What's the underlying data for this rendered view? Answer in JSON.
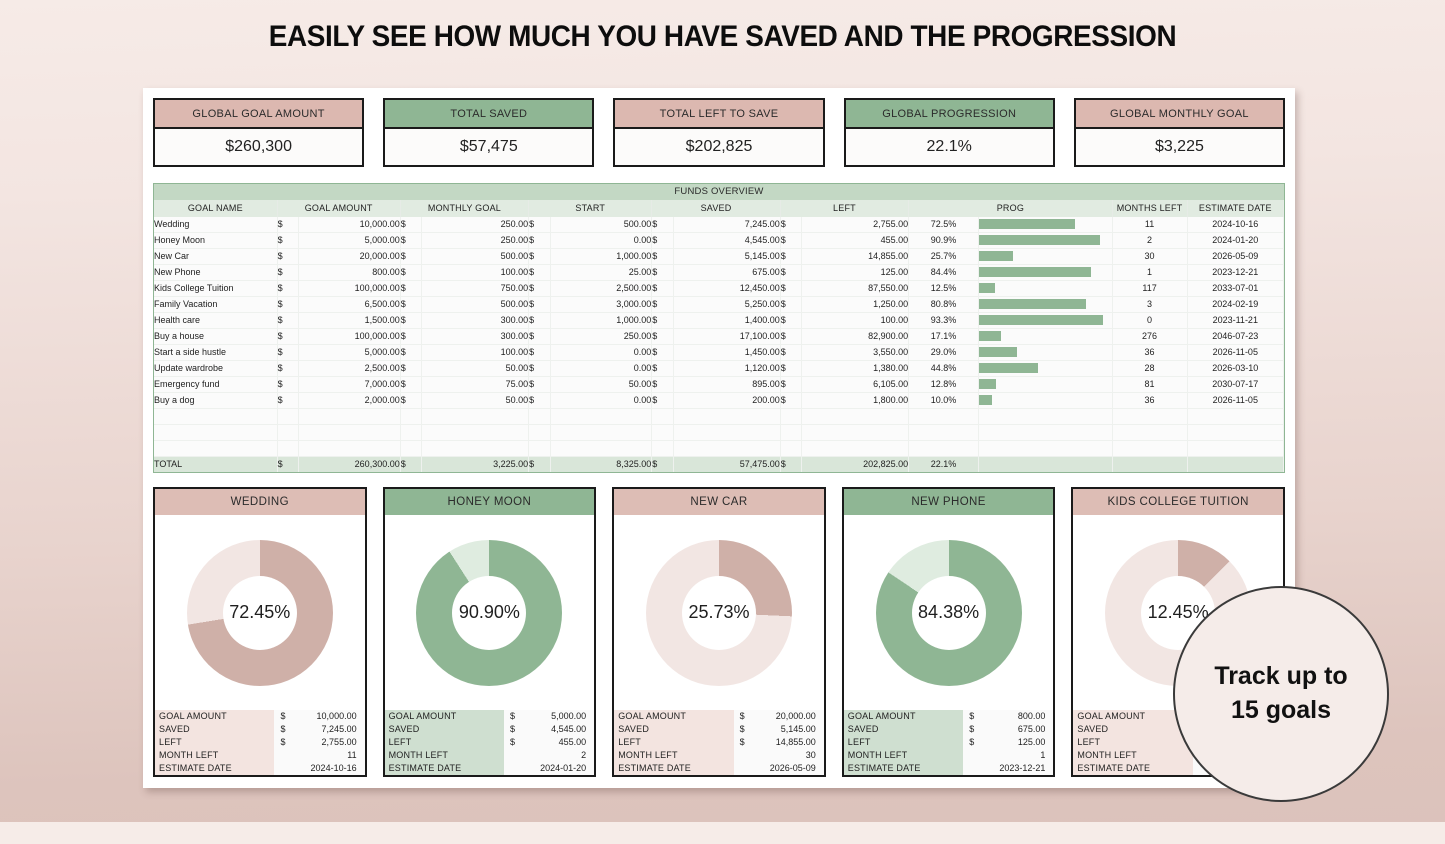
{
  "page": {
    "title": "EASILY SEE HOW MUCH YOU HAVE SAVED AND THE PROGRESSION",
    "badge_line1": "Track up to",
    "badge_line2": "15 goals"
  },
  "colors": {
    "pink_header": "#dcb8b0",
    "green_header": "#8fb694",
    "pink_fill": "#cfb0a8",
    "pink_track": "#f2e6e3",
    "green_fill": "#8fb694",
    "green_track": "#dfece0",
    "table_header": "#e1ebe1",
    "total_row": "#d9e6d9"
  },
  "kpis": [
    {
      "label": "GLOBAL GOAL AMOUNT",
      "value": "$260,300",
      "tone": "pink"
    },
    {
      "label": "TOTAL SAVED",
      "value": "$57,475",
      "tone": "green"
    },
    {
      "label": "TOTAL LEFT TO SAVE",
      "value": "$202,825",
      "tone": "pink"
    },
    {
      "label": "GLOBAL PROGRESSION",
      "value": "22.1%",
      "tone": "green"
    },
    {
      "label": "GLOBAL MONTHLY GOAL",
      "value": "$3,225",
      "tone": "pink"
    }
  ],
  "table": {
    "title": "FUNDS OVERVIEW",
    "columns": [
      "GOAL NAME",
      "GOAL AMOUNT",
      "MONTHLY GOAL",
      "START",
      "SAVED",
      "LEFT",
      "PROG",
      "MONTHS LEFT",
      "ESTIMATE DATE"
    ],
    "currency_symbol": "$",
    "rows": [
      {
        "name": "Wedding",
        "goal": "10,000.00",
        "monthly": "250.00",
        "start": "500.00",
        "saved": "7,245.00",
        "left": "2,755.00",
        "prog": "72.5%",
        "prog_value": 72.5,
        "months": "11",
        "date": "2024-10-16"
      },
      {
        "name": "Honey Moon",
        "goal": "5,000.00",
        "monthly": "250.00",
        "start": "0.00",
        "saved": "4,545.00",
        "left": "455.00",
        "prog": "90.9%",
        "prog_value": 90.9,
        "months": "2",
        "date": "2024-01-20"
      },
      {
        "name": "New Car",
        "goal": "20,000.00",
        "monthly": "500.00",
        "start": "1,000.00",
        "saved": "5,145.00",
        "left": "14,855.00",
        "prog": "25.7%",
        "prog_value": 25.7,
        "months": "30",
        "date": "2026-05-09"
      },
      {
        "name": "New Phone",
        "goal": "800.00",
        "monthly": "100.00",
        "start": "25.00",
        "saved": "675.00",
        "left": "125.00",
        "prog": "84.4%",
        "prog_value": 84.4,
        "months": "1",
        "date": "2023-12-21"
      },
      {
        "name": "Kids College Tuition",
        "goal": "100,000.00",
        "monthly": "750.00",
        "start": "2,500.00",
        "saved": "12,450.00",
        "left": "87,550.00",
        "prog": "12.5%",
        "prog_value": 12.5,
        "months": "117",
        "date": "2033-07-01"
      },
      {
        "name": "Family Vacation",
        "goal": "6,500.00",
        "monthly": "500.00",
        "start": "3,000.00",
        "saved": "5,250.00",
        "left": "1,250.00",
        "prog": "80.8%",
        "prog_value": 80.8,
        "months": "3",
        "date": "2024-02-19"
      },
      {
        "name": "Health care",
        "goal": "1,500.00",
        "monthly": "300.00",
        "start": "1,000.00",
        "saved": "1,400.00",
        "left": "100.00",
        "prog": "93.3%",
        "prog_value": 93.3,
        "months": "0",
        "date": "2023-11-21"
      },
      {
        "name": "Buy a house",
        "goal": "100,000.00",
        "monthly": "300.00",
        "start": "250.00",
        "saved": "17,100.00",
        "left": "82,900.00",
        "prog": "17.1%",
        "prog_value": 17.1,
        "months": "276",
        "date": "2046-07-23"
      },
      {
        "name": "Start a side hustle",
        "goal": "5,000.00",
        "monthly": "100.00",
        "start": "0.00",
        "saved": "1,450.00",
        "left": "3,550.00",
        "prog": "29.0%",
        "prog_value": 29.0,
        "months": "36",
        "date": "2026-11-05"
      },
      {
        "name": "Update wardrobe",
        "goal": "2,500.00",
        "monthly": "50.00",
        "start": "0.00",
        "saved": "1,120.00",
        "left": "1,380.00",
        "prog": "44.8%",
        "prog_value": 44.8,
        "months": "28",
        "date": "2026-03-10"
      },
      {
        "name": "Emergency fund",
        "goal": "7,000.00",
        "monthly": "75.00",
        "start": "50.00",
        "saved": "895.00",
        "left": "6,105.00",
        "prog": "12.8%",
        "prog_value": 12.8,
        "months": "81",
        "date": "2030-07-17"
      },
      {
        "name": "Buy a dog",
        "goal": "2,000.00",
        "monthly": "50.00",
        "start": "0.00",
        "saved": "200.00",
        "left": "1,800.00",
        "prog": "10.0%",
        "prog_value": 10.0,
        "months": "36",
        "date": "2026-11-05"
      }
    ],
    "blank_rows": 3,
    "total": {
      "label": "TOTAL",
      "goal": "260,300.00",
      "monthly": "3,225.00",
      "start": "8,325.00",
      "saved": "57,475.00",
      "left": "202,825.00",
      "prog": "22.1%"
    }
  },
  "goal_cards": {
    "stat_labels": [
      "GOAL AMOUNT",
      "SAVED",
      "LEFT",
      "MONTH LEFT",
      "ESTIMATE DATE"
    ],
    "currency_symbol": "$",
    "items": [
      {
        "title": "WEDDING",
        "tone": "pink",
        "percent_label": "72.45%",
        "percent": 72.45,
        "goal": "10,000.00",
        "saved": "7,245.00",
        "left": "2,755.00",
        "months": "11",
        "date": "2024-10-16"
      },
      {
        "title": "HONEY MOON",
        "tone": "green",
        "percent_label": "90.90%",
        "percent": 90.9,
        "goal": "5,000.00",
        "saved": "4,545.00",
        "left": "455.00",
        "months": "2",
        "date": "2024-01-20"
      },
      {
        "title": "NEW CAR",
        "tone": "pink",
        "percent_label": "25.73%",
        "percent": 25.73,
        "goal": "20,000.00",
        "saved": "5,145.00",
        "left": "14,855.00",
        "months": "30",
        "date": "2026-05-09"
      },
      {
        "title": "NEW PHONE",
        "tone": "green",
        "percent_label": "84.38%",
        "percent": 84.38,
        "goal": "800.00",
        "saved": "675.00",
        "left": "125.00",
        "months": "1",
        "date": "2023-12-21"
      },
      {
        "title": "KIDS COLLEGE TUITION",
        "tone": "pink",
        "percent_label": "12.45%",
        "percent": 12.45,
        "goal": "",
        "saved": "",
        "left": "",
        "months": "",
        "date": ""
      }
    ]
  },
  "chart_data": [
    {
      "type": "bar",
      "title": "PROG",
      "categories": [
        "Wedding",
        "Honey Moon",
        "New Car",
        "New Phone",
        "Kids College Tuition",
        "Family Vacation",
        "Health care",
        "Buy a house",
        "Start a side hustle",
        "Update wardrobe",
        "Emergency fund",
        "Buy a dog"
      ],
      "values": [
        72.5,
        90.9,
        25.7,
        84.4,
        12.5,
        80.8,
        93.3,
        17.1,
        29.0,
        44.8,
        12.8,
        10.0
      ],
      "xlabel": "",
      "ylabel": "",
      "xlim": [
        0,
        100
      ],
      "grid": false,
      "legend": false
    },
    {
      "type": "pie",
      "title": "WEDDING",
      "labels": [
        "Saved",
        "Left"
      ],
      "values": [
        72.45,
        27.55
      ]
    },
    {
      "type": "pie",
      "title": "HONEY MOON",
      "labels": [
        "Saved",
        "Left"
      ],
      "values": [
        90.9,
        9.1
      ]
    },
    {
      "type": "pie",
      "title": "NEW CAR",
      "labels": [
        "Saved",
        "Left"
      ],
      "values": [
        25.73,
        74.27
      ]
    },
    {
      "type": "pie",
      "title": "NEW PHONE",
      "labels": [
        "Saved",
        "Left"
      ],
      "values": [
        84.38,
        15.62
      ]
    },
    {
      "type": "pie",
      "title": "KIDS COLLEGE TUITION",
      "labels": [
        "Saved",
        "Left"
      ],
      "values": [
        12.45,
        87.55
      ]
    }
  ]
}
